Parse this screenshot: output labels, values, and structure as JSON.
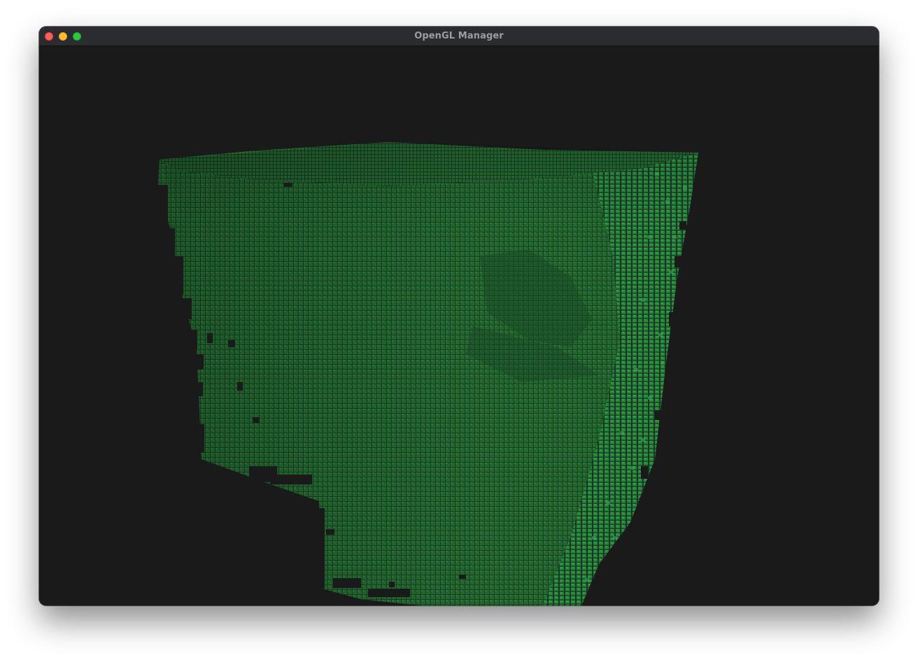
{
  "window": {
    "title": "OpenGL Manager",
    "controls": {
      "close_icon": "close-icon",
      "minimize_icon": "minimize-icon",
      "maximize_icon": "maximize-icon"
    }
  },
  "scene": {
    "background_color": "#1a1a1b",
    "object": "voxel-cube",
    "voxel_color_dark": "#1c4a28",
    "voxel_color_mid": "#22652f",
    "voxel_color_light": "#2e8e42"
  }
}
